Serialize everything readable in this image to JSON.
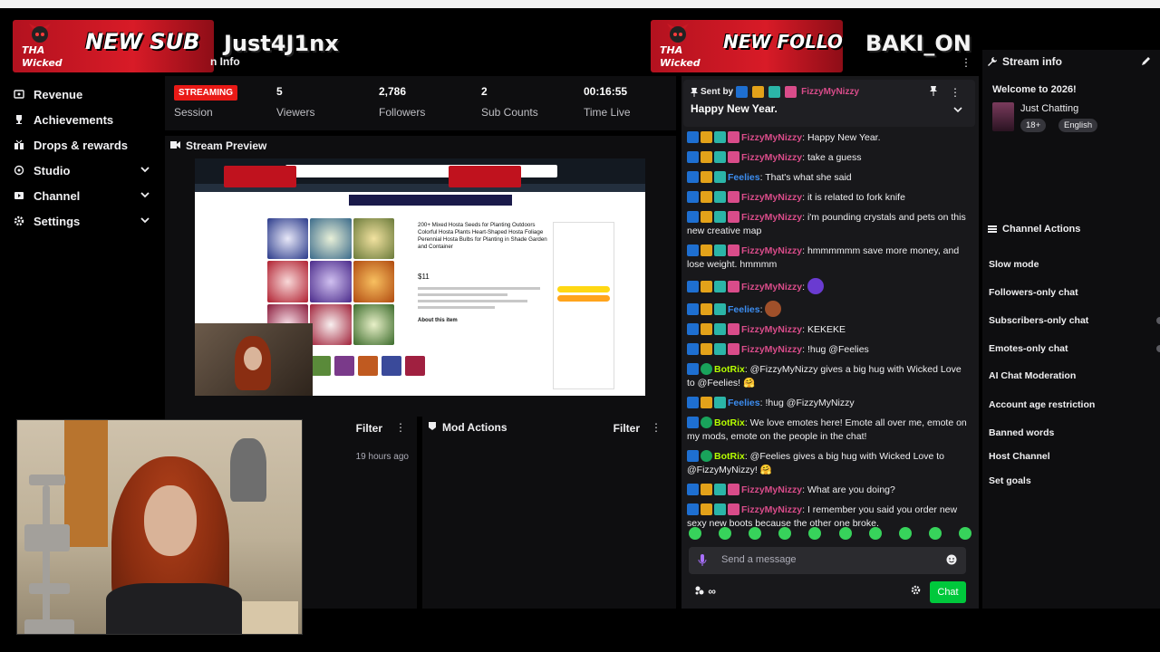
{
  "alerts": {
    "sub": {
      "text": "NEW SUB",
      "name": "Just4J1nx",
      "logo": "THA Wicked One"
    },
    "follower": {
      "text": "NEW FOLLOWER",
      "name": "BAKI_ON",
      "logo": "THA Wicked One"
    }
  },
  "nav": [
    {
      "label": "Revenue",
      "icon": "dollar-icon",
      "chevron": false
    },
    {
      "label": "Achievements",
      "icon": "trophy-icon",
      "chevron": false
    },
    {
      "label": "Drops & rewards",
      "icon": "gift-icon",
      "chevron": false
    },
    {
      "label": "Studio",
      "icon": "camera-icon",
      "chevron": true
    },
    {
      "label": "Channel",
      "icon": "channel-icon",
      "chevron": true
    },
    {
      "label": "Settings",
      "icon": "gear-icon",
      "chevron": true
    }
  ],
  "stream_info_partial": "n Info",
  "stats": {
    "session": {
      "badge": "STREAMING",
      "label": "Session"
    },
    "viewers": {
      "value": "5",
      "label": "Viewers"
    },
    "followers": {
      "value": "2,786",
      "label": "Followers"
    },
    "subs": {
      "value": "2",
      "label": "Sub Counts"
    },
    "time": {
      "value": "00:16:55",
      "label": "Time Live"
    }
  },
  "preview": {
    "title": "Stream Preview",
    "product_title": "200+ Mixed Hosta Seeds for Planting Outdoors Colorful Hosta Plants Heart-Shaped Hosta Foliage Perennial Hosta Bulbs for Planting in Shade Garden and Container",
    "price": "$11",
    "about": "About this item"
  },
  "activity": {
    "filter": "Filter",
    "time": "19 hours ago"
  },
  "mod_actions": {
    "title": "Mod Actions",
    "filter": "Filter"
  },
  "chat": {
    "pinned": {
      "sent_by": "Sent by",
      "user": "FizzyMyNizzy",
      "message": "Happy New Year."
    },
    "messages": [
      {
        "user": "FizzyMyNizzy",
        "color": "#d94c8a",
        "badges": [
          "b-blue",
          "b-gold",
          "b-teal",
          "b-pink"
        ],
        "text": ": Happy New Year."
      },
      {
        "user": "FizzyMyNizzy",
        "color": "#d94c8a",
        "badges": [
          "b-blue",
          "b-gold",
          "b-teal",
          "b-pink"
        ],
        "text": ": take a guess"
      },
      {
        "user": "Feelies",
        "color": "#3c8df0",
        "badges": [
          "b-blue",
          "b-gold",
          "b-teal"
        ],
        "text": ": That's what she said"
      },
      {
        "user": "FizzyMyNizzy",
        "color": "#d94c8a",
        "badges": [
          "b-blue",
          "b-gold",
          "b-teal",
          "b-pink"
        ],
        "text": ": it is related to fork knife"
      },
      {
        "user": "FizzyMyNizzy",
        "color": "#d94c8a",
        "badges": [
          "b-blue",
          "b-gold",
          "b-teal",
          "b-pink"
        ],
        "text": ": i'm pounding crystals and pets on this new creative map"
      },
      {
        "user": "FizzyMyNizzy",
        "color": "#d94c8a",
        "badges": [
          "b-blue",
          "b-gold",
          "b-teal",
          "b-pink"
        ],
        "text": ": hmmmmmm save more money, and lose weight. hmmmm"
      },
      {
        "user": "FizzyMyNizzy",
        "color": "#d94c8a",
        "badges": [
          "b-blue",
          "b-gold",
          "b-teal",
          "b-pink"
        ],
        "text": ":",
        "emote": "#6a3bd1"
      },
      {
        "user": "Feelies",
        "color": "#3c8df0",
        "badges": [
          "b-blue",
          "b-gold",
          "b-teal"
        ],
        "text": ":",
        "emote": "#a0502a"
      },
      {
        "user": "FizzyMyNizzy",
        "color": "#d94c8a",
        "badges": [
          "b-blue",
          "b-gold",
          "b-teal",
          "b-pink"
        ],
        "text": ": KEKEKE"
      },
      {
        "user": "FizzyMyNizzy",
        "color": "#d94c8a",
        "badges": [
          "b-blue",
          "b-gold",
          "b-teal",
          "b-pink"
        ],
        "text": ": !hug @Feelies"
      },
      {
        "user": "BotRix",
        "color": "#b6ff00",
        "badges": [
          "b-blue",
          "b-green"
        ],
        "text": ": @FizzyMyNizzy gives a big hug with Wicked Love to @Feelies! 🤗"
      },
      {
        "user": "Feelies",
        "color": "#3c8df0",
        "badges": [
          "b-blue",
          "b-gold",
          "b-teal"
        ],
        "text": ": !hug @FizzyMyNizzy"
      },
      {
        "user": "BotRix",
        "color": "#b6ff00",
        "badges": [
          "b-blue",
          "b-green"
        ],
        "text": ": We love emotes here! Emote all over me, emote on my mods, emote on the people in the chat!"
      },
      {
        "user": "BotRix",
        "color": "#b6ff00",
        "badges": [
          "b-blue",
          "b-green"
        ],
        "text": ": @Feelies gives a big hug with Wicked Love to @FizzyMyNizzy! 🤗"
      },
      {
        "user": "FizzyMyNizzy",
        "color": "#d94c8a",
        "badges": [
          "b-blue",
          "b-gold",
          "b-teal",
          "b-pink"
        ],
        "text": ": What are you doing?"
      },
      {
        "user": "FizzyMyNizzy",
        "color": "#d94c8a",
        "badges": [
          "b-blue",
          "b-gold",
          "b-teal",
          "b-pink"
        ],
        "text": ": I remember you said you order new sexy new boots because the other one broke."
      }
    ],
    "input_placeholder": "Send a message",
    "points": "∞",
    "chat_button": "Chat"
  },
  "right_panel": {
    "title": "Stream info",
    "welcome": "Welcome to 2026!",
    "category": "Just Chatting",
    "tags": [
      "18+",
      "English"
    ],
    "channel_actions_title": "Channel Actions",
    "actions": [
      "Slow mode",
      "Followers-only chat",
      "Subscribers-only chat",
      "Emotes-only chat",
      "AI Chat Moderation",
      "Account age restriction",
      "Banned words",
      "Host Channel",
      "Set goals"
    ]
  },
  "colors": {
    "accent_green": "#00c83c",
    "live_red": "#e91916",
    "alert_red": "#d81b27",
    "fizzy_pink": "#d94c8a",
    "feelies_blue": "#3c8df0",
    "botrix_green": "#b6ff00"
  }
}
